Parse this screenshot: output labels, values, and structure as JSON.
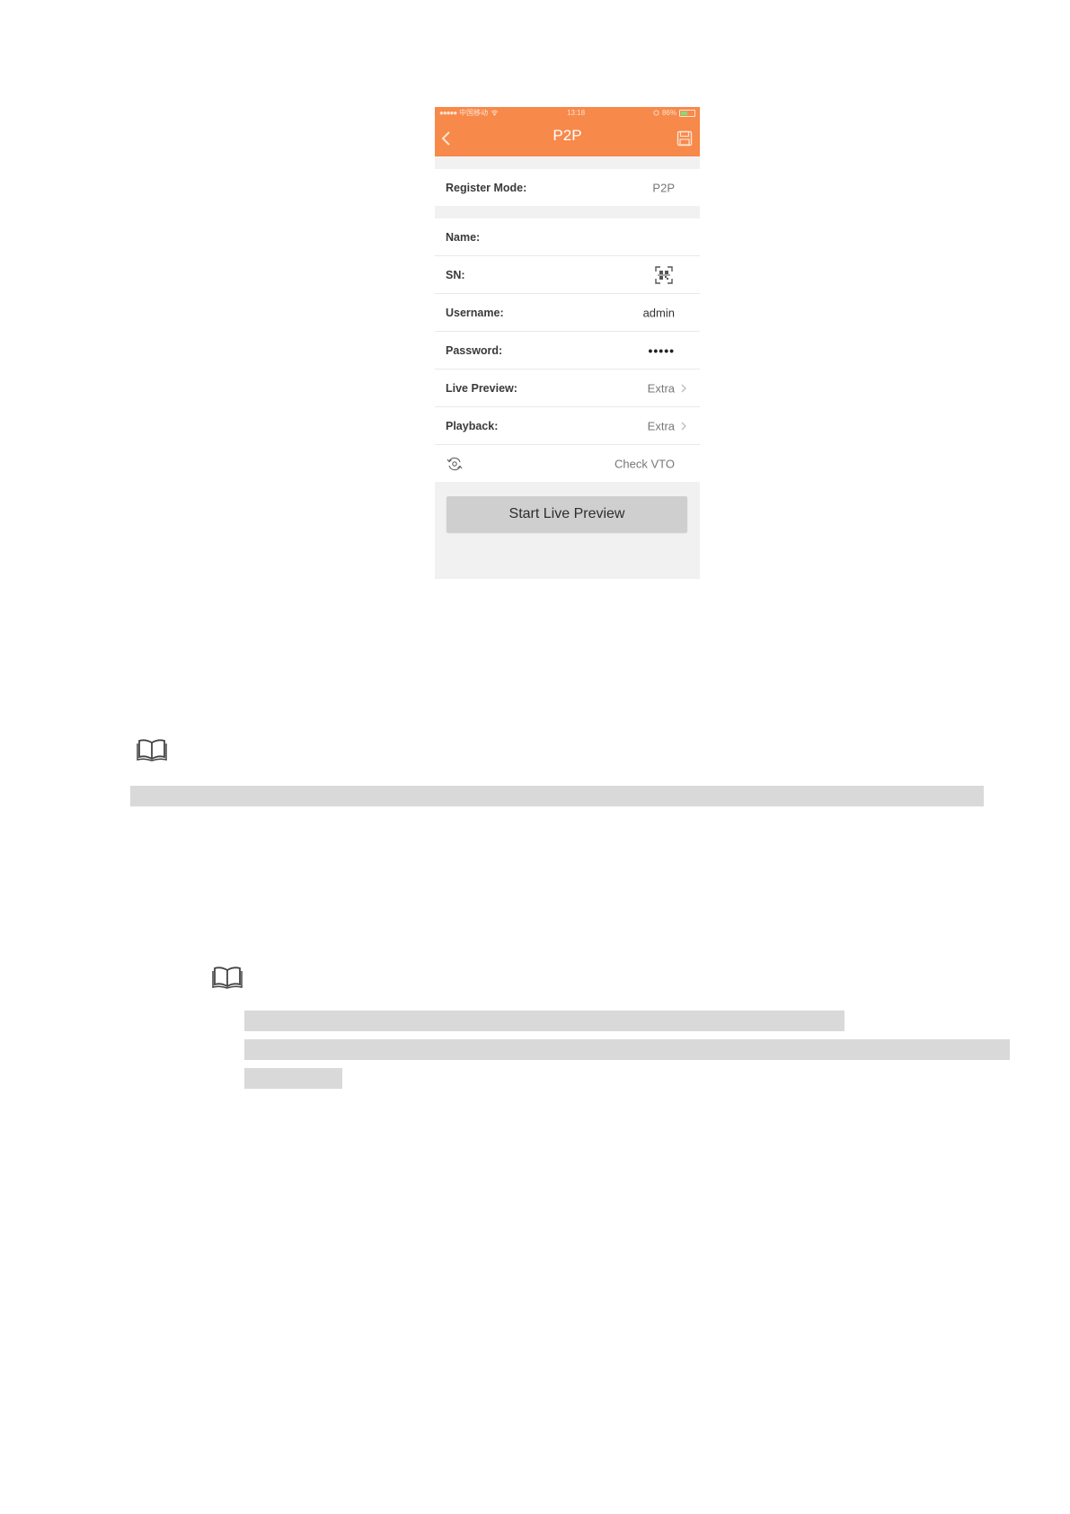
{
  "phone": {
    "statusbar": {
      "carrier": "中国移动",
      "time": "13:18",
      "battery": "86%",
      "icon_names": [
        "signal-dots-icon",
        "wifi-icon",
        "location-icon",
        "battery-icon"
      ]
    },
    "navbar": {
      "title": "P2P",
      "icon_names": [
        "back-chevron-icon",
        "save-icon"
      ]
    },
    "form": {
      "register_mode": {
        "label": "Register Mode:",
        "value": "P2P"
      },
      "name": {
        "label": "Name:",
        "value": ""
      },
      "sn": {
        "label": "SN:",
        "icon": "qr-scan-icon"
      },
      "username": {
        "label": "Username:",
        "value": "admin"
      },
      "password": {
        "label": "Password:",
        "value": "•••••"
      },
      "live_preview": {
        "label": "Live Preview:",
        "value": "Extra"
      },
      "playback": {
        "label": "Playback:",
        "value": "Extra"
      },
      "check_vto": {
        "icon": "refresh-icon",
        "label": "Check VTO"
      }
    },
    "start_button": "Start Live Preview",
    "colors": {
      "accent": "#f7894a",
      "background": "#f1f1f1",
      "button": "#cfcfcf"
    }
  },
  "document": {
    "note_icons": [
      "book-icon",
      "book-icon"
    ],
    "redacted_bar_color": "#d9d9d9"
  }
}
